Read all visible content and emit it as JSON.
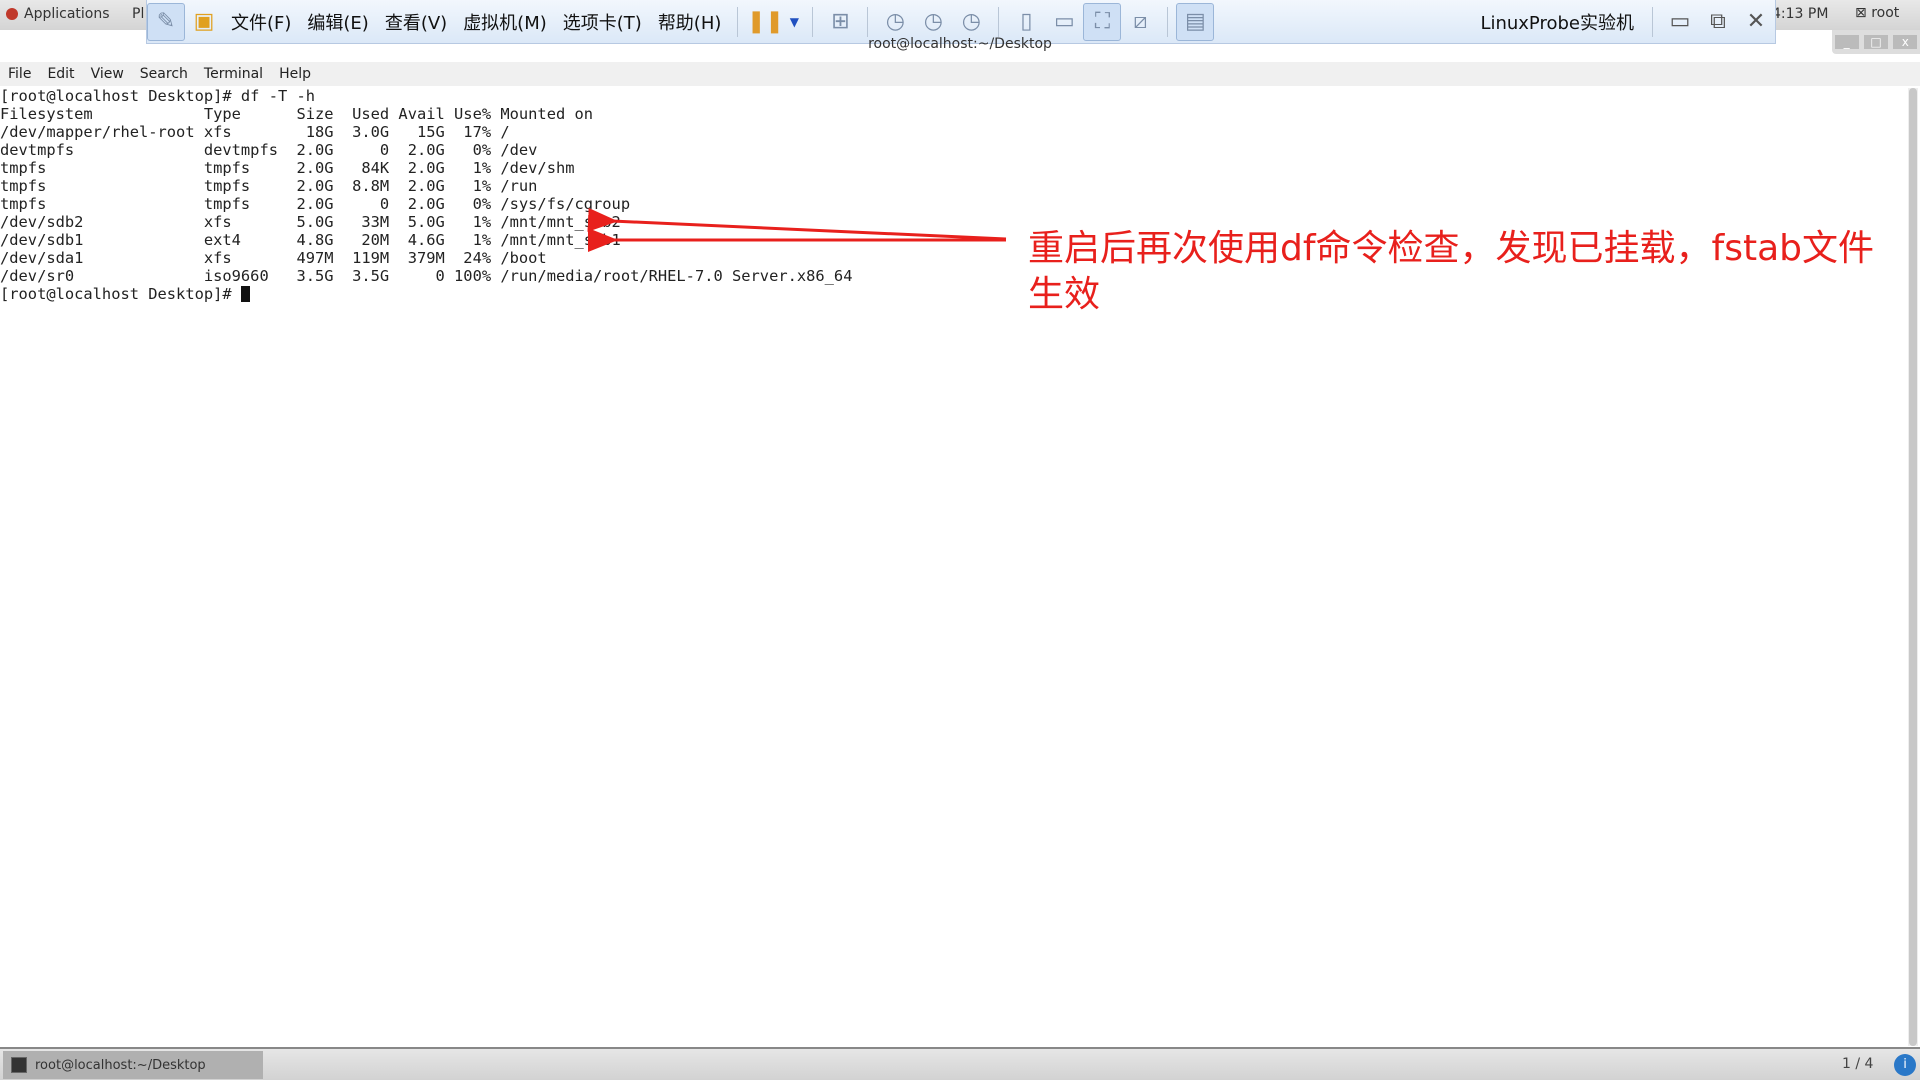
{
  "top_panel": {
    "applications": "Applications",
    "places": "Pl",
    "clock": "4:13 PM",
    "user": "root"
  },
  "vm_toolbar": {
    "menus": [
      "文件(F)",
      "编辑(E)",
      "查看(V)",
      "虚拟机(M)",
      "选项卡(T)",
      "帮助(H)"
    ],
    "title": "LinuxProbe实验机"
  },
  "terminal_window": {
    "title": "root@localhost:~/Desktop",
    "menu": [
      "File",
      "Edit",
      "View",
      "Search",
      "Terminal",
      "Help"
    ]
  },
  "terminal": {
    "lines": [
      "[root@localhost Desktop]# df -T -h",
      "Filesystem            Type      Size  Used Avail Use% Mounted on",
      "/dev/mapper/rhel-root xfs        18G  3.0G   15G  17% /",
      "devtmpfs              devtmpfs  2.0G     0  2.0G   0% /dev",
      "tmpfs                 tmpfs     2.0G   84K  2.0G   1% /dev/shm",
      "tmpfs                 tmpfs     2.0G  8.8M  2.0G   1% /run",
      "tmpfs                 tmpfs     2.0G     0  2.0G   0% /sys/fs/cgroup",
      "/dev/sdb2             xfs       5.0G   33M  5.0G   1% /mnt/mnt_sdb2",
      "/dev/sdb1             ext4      4.8G   20M  4.6G   1% /mnt/mnt_sdb1",
      "/dev/sda1             xfs       497M  119M  379M  24% /boot",
      "/dev/sr0              iso9660   3.5G  3.5G     0 100% /run/media/root/RHEL-7.0 Server.x86_64"
    ],
    "prompt": "[root@localhost Desktop]# "
  },
  "annotation": {
    "text": "重启后再次使用df命令检查，发现已挂载，fstab文件生效",
    "color": "#e8201c"
  },
  "taskbar": {
    "task": "root@localhost:~/Desktop",
    "workspace": "1 / 4",
    "info": "i"
  }
}
